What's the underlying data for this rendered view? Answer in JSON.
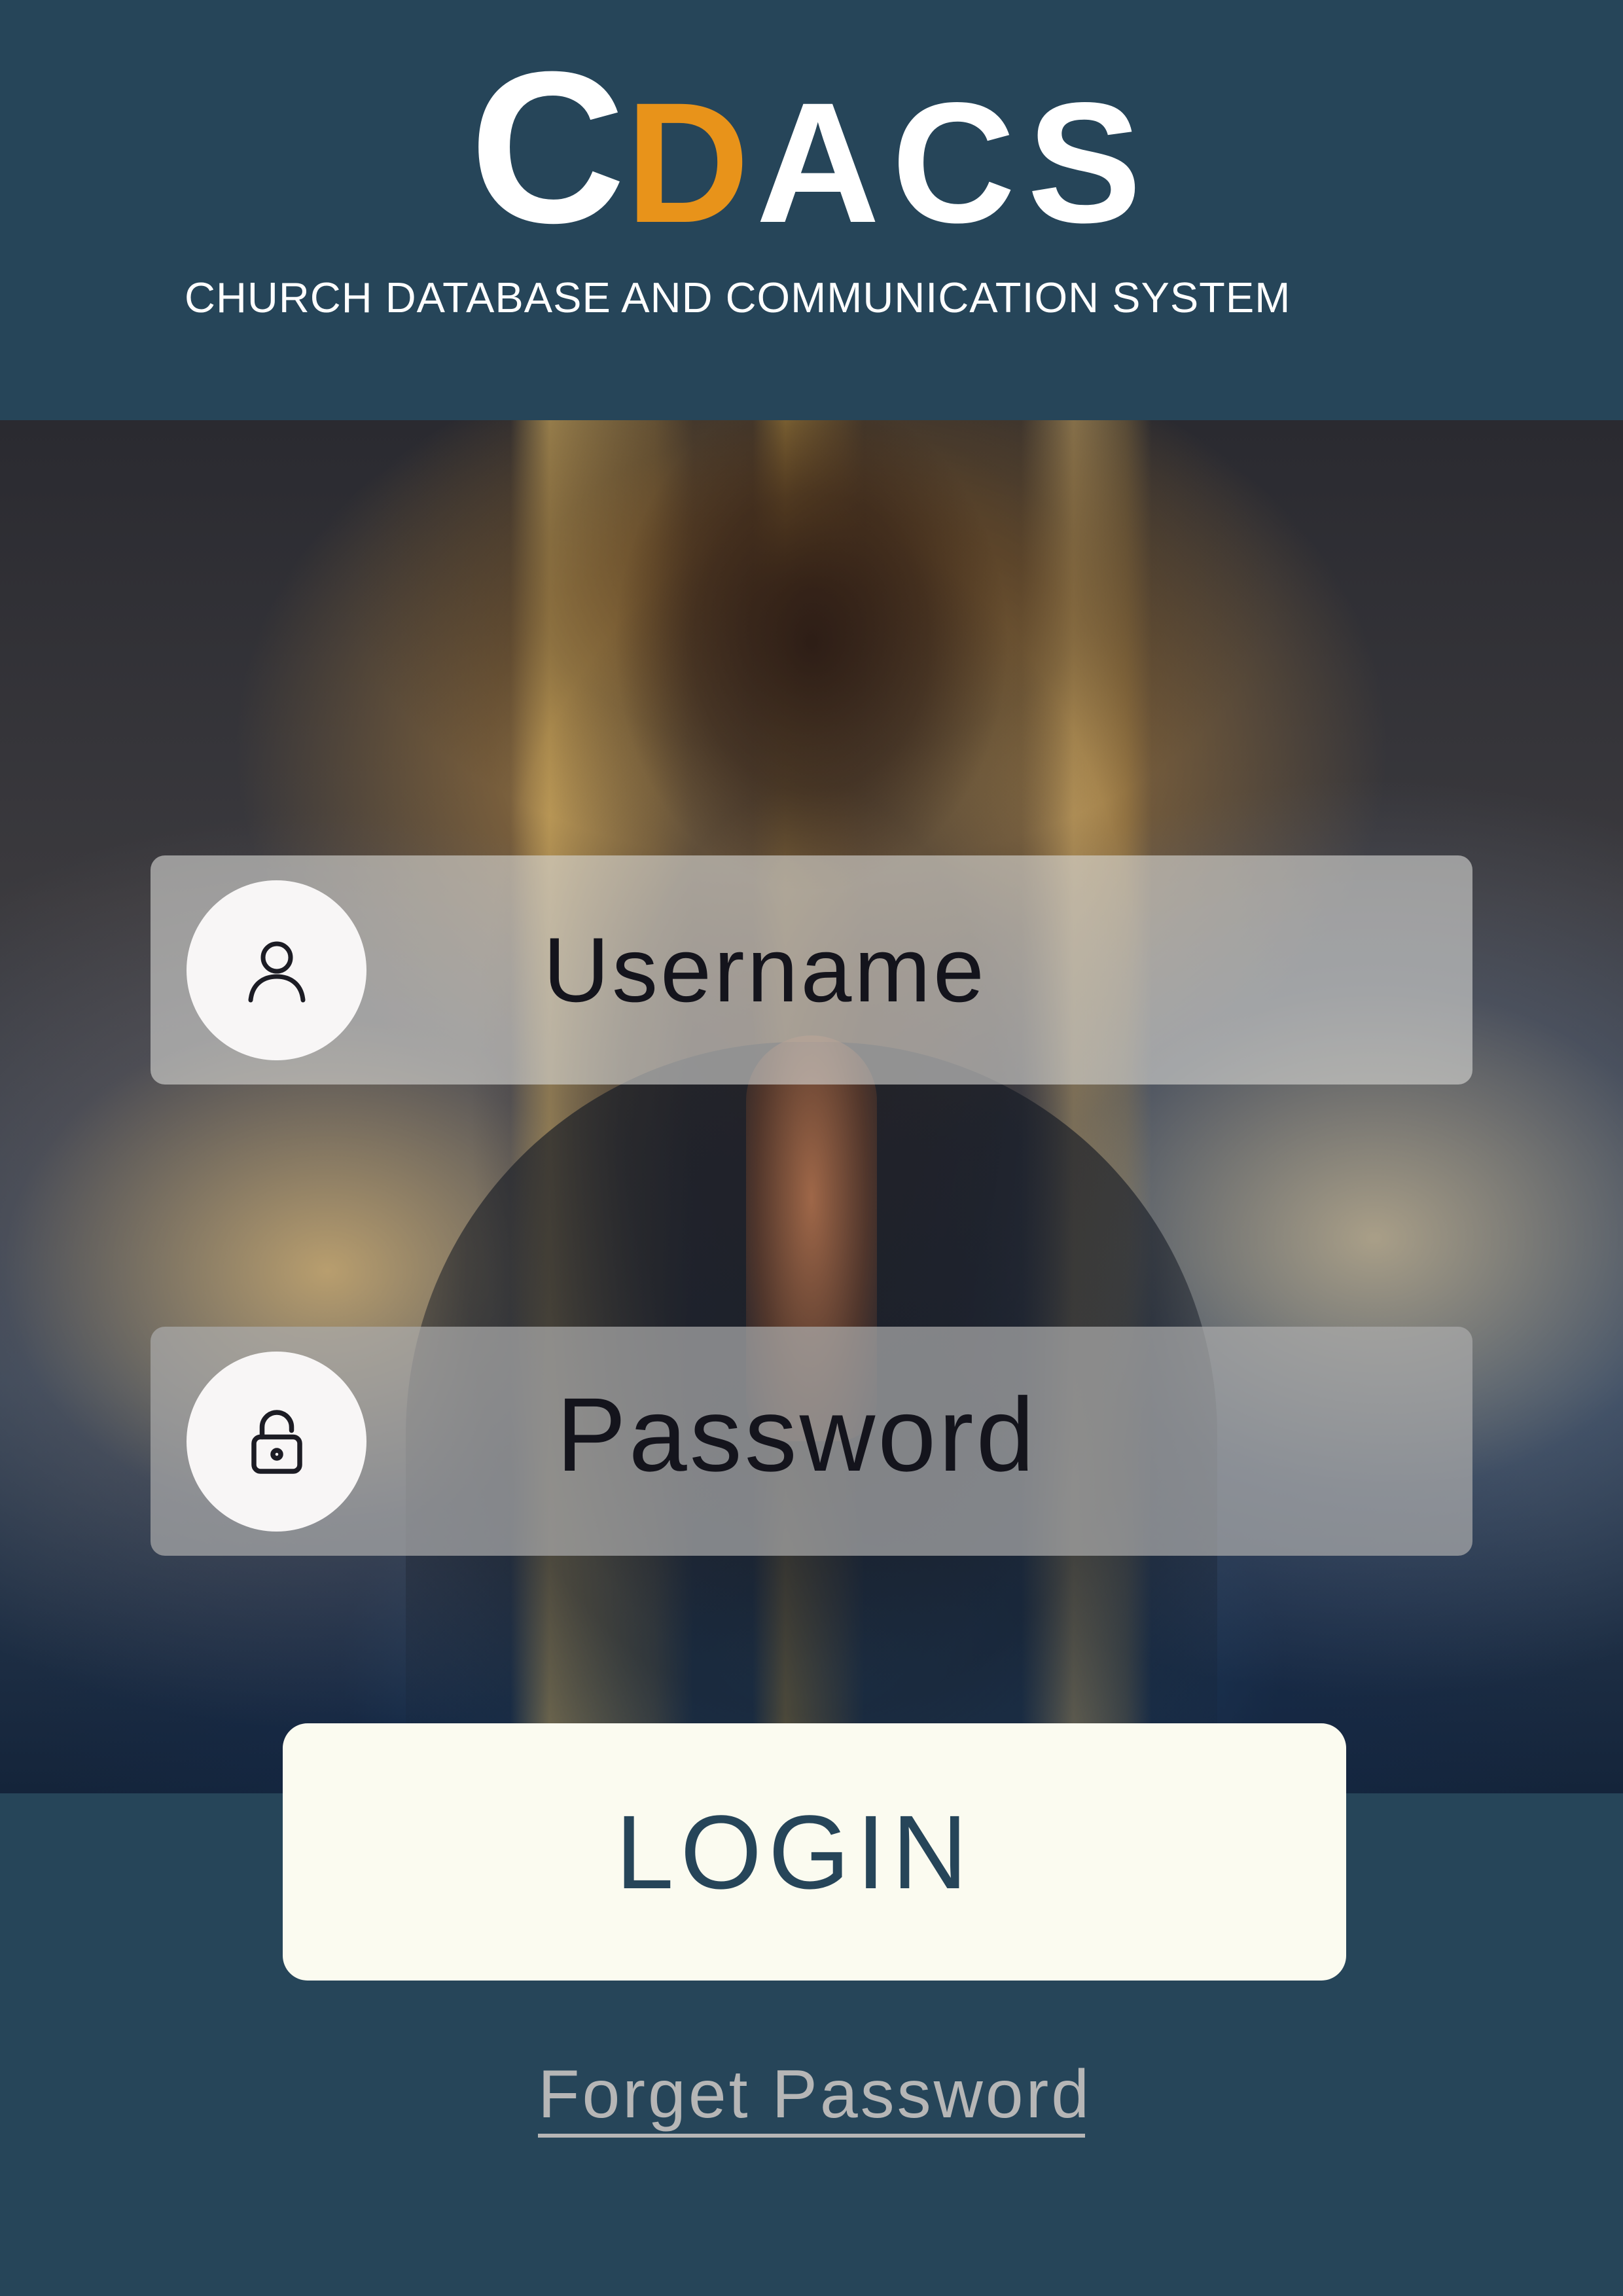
{
  "brand": {
    "logo_first": "C",
    "logo_accent": "D",
    "logo_rest": "ACS",
    "tagline": "CHURCH DATABASE AND COMMUNICATION SYSTEM",
    "colors": {
      "primary": "#264559",
      "accent": "#e8931a",
      "logo_text": "#ffffff"
    }
  },
  "hero": {
    "image": "praying-person-clouds-light-background"
  },
  "form": {
    "username": {
      "placeholder": "Username",
      "icon": "user-icon"
    },
    "password": {
      "placeholder": "Password",
      "icon": "lock-icon"
    },
    "login_label": "LOGIN",
    "forget_label": "Forget Password"
  }
}
